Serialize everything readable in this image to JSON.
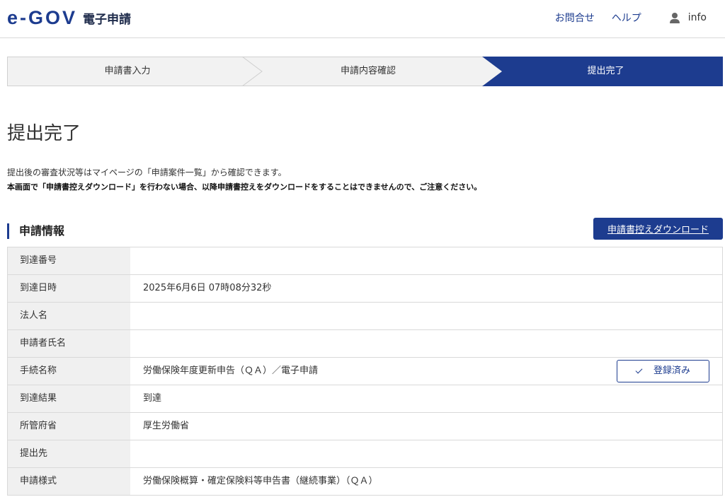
{
  "header": {
    "logo_mark": "e-GOV",
    "logo_text": "電子申請",
    "contact": "お問合せ",
    "help": "ヘルプ",
    "user": "info"
  },
  "stepper": {
    "steps": [
      {
        "label": "申請書入力",
        "active": false
      },
      {
        "label": "申請内容確認",
        "active": false
      },
      {
        "label": "提出完了",
        "active": true
      }
    ],
    "active_color": "#1d3c8f"
  },
  "page": {
    "title": "提出完了",
    "message": "提出後の審査状況等はマイページの「申請案件一覧」から確認できます。",
    "warning": "本画面で「申請書控えダウンロード」を行わない場合、以降申請書控えをダウンロードをすることはできませんので、ご注意ください。"
  },
  "section": {
    "title": "申請情報",
    "download_button": "申請書控えダウンロード"
  },
  "table": {
    "rows": [
      {
        "label": "到達番号",
        "value": ""
      },
      {
        "label": "到達日時",
        "value": "2025年6月6日 07時08分32秒"
      },
      {
        "label": "法人名",
        "value": ""
      },
      {
        "label": "申請者氏名",
        "value": ""
      },
      {
        "label": "手続名称",
        "value": "労働保険年度更新申告（ＱＡ）／電子申請"
      },
      {
        "label": "到達結果",
        "value": "到達"
      },
      {
        "label": "所管府省",
        "value": "厚生労働省"
      },
      {
        "label": "提出先",
        "value": ""
      },
      {
        "label": "申請様式",
        "value": "労働保険概算・確定保険料等申告書（継続事業）（ＱＡ）"
      }
    ],
    "registered_button": "登録済み"
  }
}
